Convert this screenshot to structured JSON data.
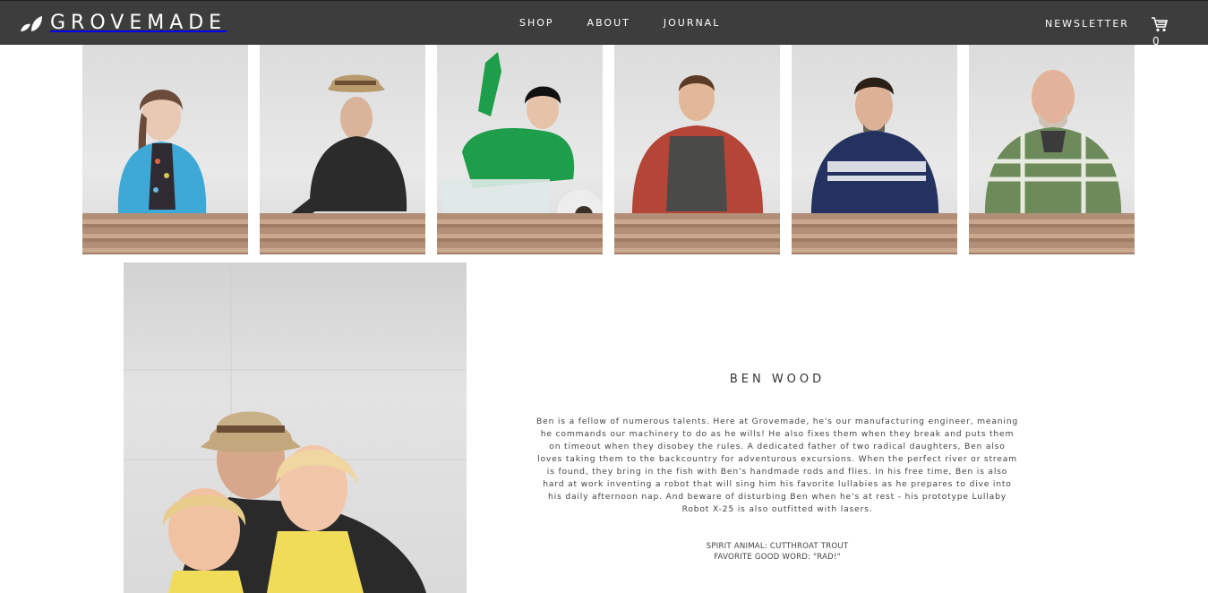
{
  "header": {
    "brand": "GROVEMADE",
    "nav": [
      "SHOP",
      "ABOUT",
      "JOURNAL"
    ],
    "newsletter": "NEWSLETTER",
    "cart_count": "0",
    "colors": {
      "bar": "#3d3d3d",
      "text": "#ffffff"
    }
  },
  "team_portraits": [
    {
      "shirt": "#3ea9d6",
      "hair": "#6b4b3a",
      "icon": "portrait-woman-braid"
    },
    {
      "shirt": "#2b2b2b",
      "hair": "#b89a6c",
      "icon": "portrait-man-hat"
    },
    {
      "shirt": "#1e9e4a",
      "hair": "#111111",
      "icon": "portrait-woman-bubblewrap"
    },
    {
      "shirt": "#b54536",
      "hair": "#5b3b25",
      "icon": "portrait-man-apron"
    },
    {
      "shirt": "#23325f",
      "hair": "#2b2018",
      "icon": "portrait-man-sweater"
    },
    {
      "shirt": "#6c8a5a",
      "hair": "#8c6e5a",
      "icon": "portrait-man-plaid"
    }
  ],
  "feature": {
    "name": "BEN WOOD",
    "bio": "Ben is a fellow of numerous talents. Here at Grovemade, he's our manufacturing engineer, meaning he commands our machinery to do as he wills! He also fixes them when they break and puts them on timeout when they disobey the rules. A dedicated father of two radical daughters, Ben also loves taking them to the backcountry for adventurous excursions. When the perfect river or stream is found, they bring in the fish with Ben's handmade rods and flies. In his free time, Ben is also hard at work inventing a robot that will sing him his favorite lullabies as he prepares to dive into his daily afternoon nap. And beware of disturbing Ben when he's at rest - his prototype Lullaby Robot X-25 is also outfitted with lasers.",
    "facts": [
      "SPIRIT ANIMAL: CUTTHROAT TROUT",
      "FAVORITE GOOD WORD: \"RAD!\""
    ]
  }
}
